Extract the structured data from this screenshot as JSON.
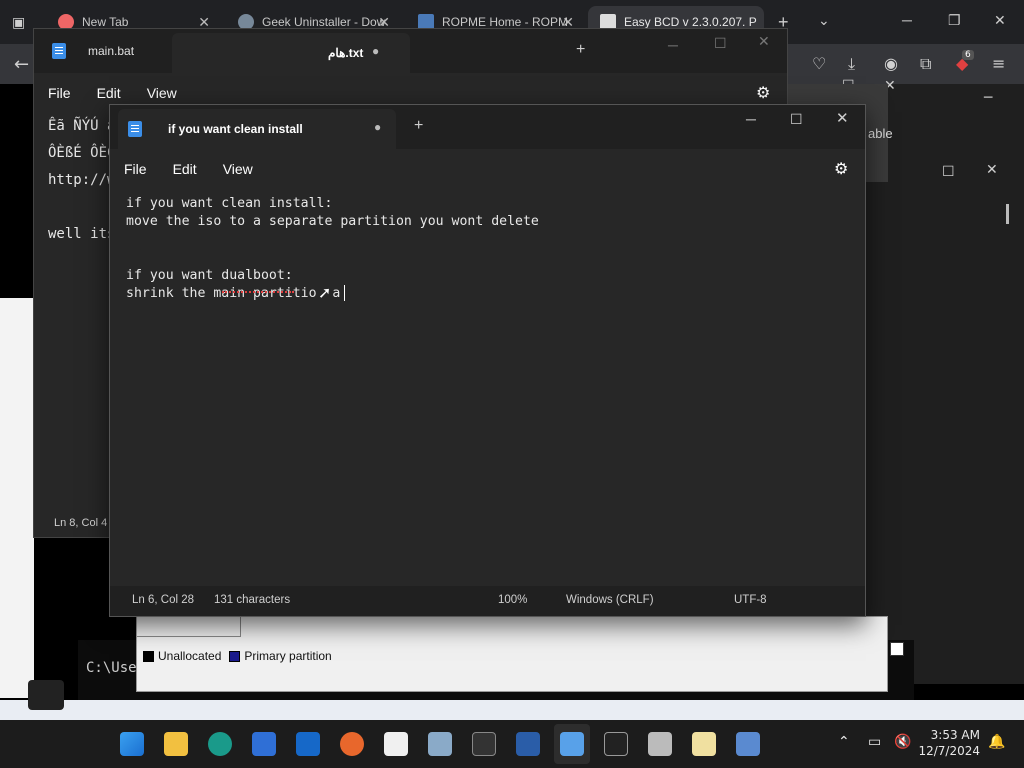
{
  "browser": {
    "tabs": [
      {
        "label": "New Tab"
      },
      {
        "label": "Geek Uninstaller - Dow"
      },
      {
        "label": "ROPME Home - ROPM"
      },
      {
        "label": "Easy BCD v 2.3.0.207. P"
      }
    ],
    "new_tab_symbol": "+",
    "badge_count": "6"
  },
  "notepad_back": {
    "tab_inactive": "main.bat",
    "tab_active": "هام.txt",
    "menu": [
      "File",
      "Edit",
      "View"
    ],
    "lines": [
      "Êã ÑÝÚ ã",
      "ÔÈßÉ ÔÈÇ",
      "http://w",
      "",
      "well its"
    ],
    "status": "Ln 8, Col 4"
  },
  "notepad_front": {
    "tab_title": "if you want clean install",
    "menu": [
      "File",
      "Edit",
      "View"
    ],
    "lines": [
      "if you want clean install:",
      "move the iso to a separate partition you wont delete",
      "",
      "",
      "if you want dualboot:",
      "shrink the main partitio  a"
    ],
    "status": {
      "position": "Ln 6, Col 28",
      "chars": "131 characters",
      "zoom": "100%",
      "eol": "Windows (CRLF)",
      "encoding": "UTF-8"
    }
  },
  "background": {
    "right_label": "able",
    "disk_legend": [
      "Unallocated",
      "Primary partition"
    ],
    "terminal_text": "C:\\Use"
  },
  "taskbar": {
    "time": "3:53 AM",
    "date": "12/7/2024"
  }
}
